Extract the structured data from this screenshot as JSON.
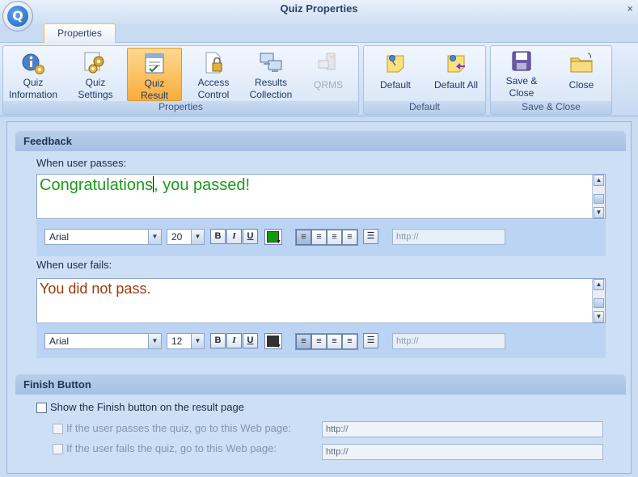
{
  "window": {
    "title": "Quiz Properties",
    "close_glyph": "×",
    "logo_letter": "Q"
  },
  "ribbon": {
    "tab_label": "Properties",
    "groups": {
      "properties": {
        "label": "Properties",
        "buttons": [
          {
            "line1": "Quiz",
            "line2": "Information",
            "icon": "info-gear-icon",
            "active": false,
            "disabled": false
          },
          {
            "line1": "Quiz",
            "line2": "Settings",
            "icon": "gears-icon",
            "active": false,
            "disabled": false
          },
          {
            "line1": "Quiz",
            "line2": "Result",
            "icon": "quiz-result-icon",
            "active": true,
            "disabled": false
          },
          {
            "line1": "Access",
            "line2": "Control",
            "icon": "lock-document-icon",
            "active": false,
            "disabled": false
          },
          {
            "line1": "Results",
            "line2": "Collection",
            "icon": "computers-icon",
            "active": false,
            "disabled": false
          },
          {
            "line1": "QRMS",
            "line2": "",
            "icon": "server-icon",
            "active": false,
            "disabled": true
          }
        ]
      },
      "default": {
        "label": "Default",
        "buttons": [
          {
            "line1": "Default",
            "icon": "pin-note-icon"
          },
          {
            "line1": "Default All",
            "icon": "pin-note-arrow-icon"
          }
        ]
      },
      "save_close": {
        "label": "Save & Close",
        "buttons": [
          {
            "line1": "Save &",
            "line2": "Close",
            "icon": "floppy-disk-icon"
          },
          {
            "line1": "Close",
            "icon": "folder-icon"
          }
        ]
      }
    }
  },
  "feedback": {
    "header": "Feedback",
    "pass_label": "When user passes:",
    "pass_text_before_caret": "Congratulations",
    "pass_text_after_caret": ", you passed!",
    "pass_text_color": "#1a9a1a",
    "pass_font": "Arial",
    "pass_size": "20",
    "pass_color_swatch": "#119911",
    "pass_url_placeholder": "http://",
    "fail_label": "When user fails:",
    "fail_text": "You did not pass.",
    "fail_text_color": "#9b3a0c",
    "fail_font": "Arial",
    "fail_size": "12",
    "fail_color_swatch": "#333333",
    "fail_url_placeholder": "http://",
    "format_buttons": {
      "bold": "B",
      "italic": "I",
      "underline": "U"
    }
  },
  "finish": {
    "header": "Finish Button",
    "show_label": "Show the Finish button on the result page",
    "show_checked": false,
    "pass_label": "If the user passes the quiz, go to this Web page:",
    "pass_url": "http://",
    "fail_label": "If the user fails the quiz, go to this Web page:",
    "fail_url": "http://"
  }
}
